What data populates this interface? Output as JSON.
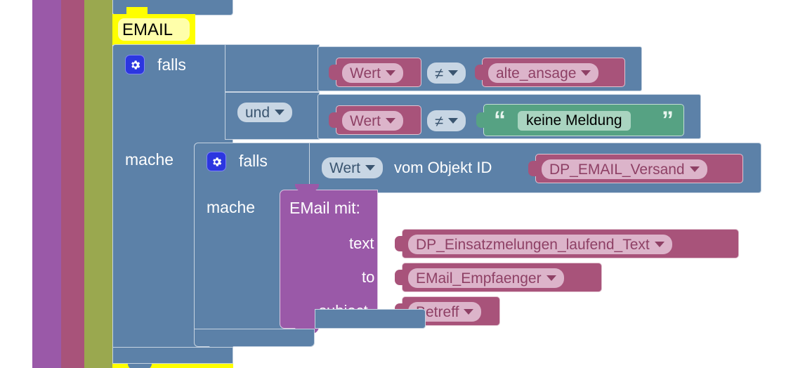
{
  "workspace": {
    "type": "blockly-visual-programming-canvas",
    "grid": "cross-dot",
    "background_color": "#ffffff"
  },
  "colors": {
    "control_blue": "#5c81a8",
    "control_blue_dark": "#4d6f94",
    "variable_rose": "#a8537a",
    "variable_rose_field": "#dcb4ca",
    "logic_field": "#c8d6e4",
    "text_green": "#56a283",
    "text_green_field": "#a9d4c0",
    "email_purple": "#9a59a8",
    "email_purple_field": "#c489cf",
    "badge_yellow": "#ffff00",
    "badge_yellow_inner": "#ffffaa",
    "stripe_purple": "#9a59a8",
    "stripe_rose": "#a8537a",
    "stripe_olive": "#9aa84f"
  },
  "left_stripes": [
    {
      "name": "stripe-purple",
      "color": "#9a59a8"
    },
    {
      "name": "stripe-rose",
      "color": "#a8537a"
    },
    {
      "name": "stripe-olive",
      "color": "#9aa84f"
    }
  ],
  "email_badge": {
    "label": "EMAIL"
  },
  "outer_if": {
    "mutator_icon": "gear-icon",
    "if_label": "falls",
    "do_label": "mache",
    "and_operator": {
      "label": "und",
      "icon": "chevron-down-icon"
    },
    "condition_1": {
      "left_variable": {
        "label": "Wert",
        "icon": "chevron-down-icon"
      },
      "operator": {
        "label": "≠",
        "icon": "chevron-down-icon"
      },
      "right_variable": {
        "label": "alte_ansage",
        "icon": "chevron-down-icon"
      }
    },
    "condition_2": {
      "left_variable": {
        "label": "Wert",
        "icon": "chevron-down-icon"
      },
      "operator": {
        "label": "≠",
        "icon": "chevron-down-icon"
      },
      "right_text": {
        "value": "keine Meldung",
        "quote_open": "“",
        "quote_close": "”"
      }
    }
  },
  "inner_if": {
    "mutator_icon": "gear-icon",
    "if_label": "falls",
    "do_label": "mache",
    "condition": {
      "value_field": {
        "label": "Wert",
        "icon": "chevron-down-icon"
      },
      "text": "vom Objekt ID",
      "object_id": {
        "label": "DP_EMAIL_Versand",
        "icon": "chevron-down-icon"
      }
    }
  },
  "email_block": {
    "title": "EMail  mit:",
    "rows": [
      {
        "label": "text",
        "value": {
          "label": "DP_Einsatzmelungen_laufend_Text",
          "icon": "chevron-down-icon"
        }
      },
      {
        "label": "to",
        "value": {
          "label": "EMail_Empfaenger",
          "icon": "chevron-down-icon"
        }
      },
      {
        "label": "subject",
        "value": {
          "label": "Betreff",
          "icon": "chevron-down-icon"
        }
      }
    ]
  }
}
